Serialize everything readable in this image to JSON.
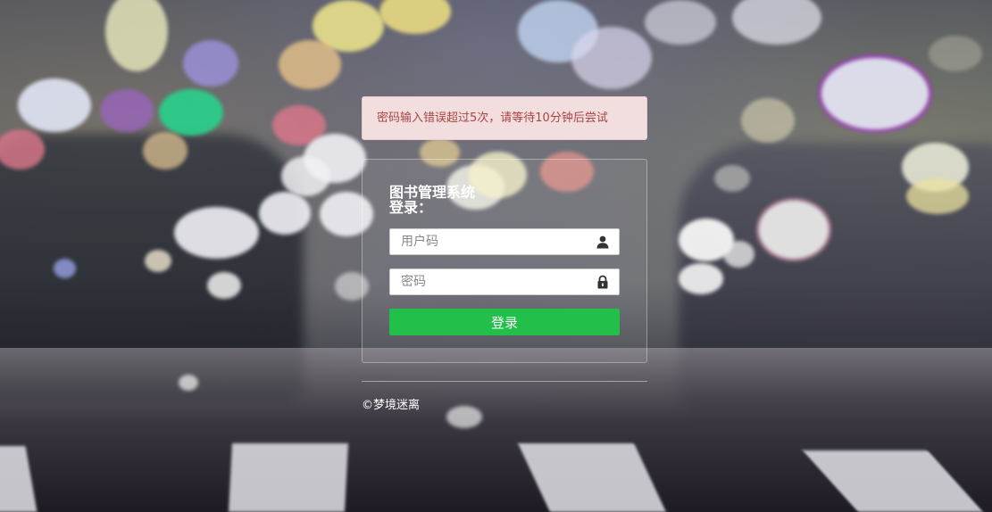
{
  "alert": {
    "message": "密码输入错误超过5次，请等待10分钟后尝试",
    "background_color": "#f2dede",
    "text_color": "#a94442"
  },
  "login": {
    "title": "图书管理系统登录：",
    "username_placeholder": "用户码",
    "username_icon": "user-icon",
    "password_placeholder": "密码",
    "password_icon": "lock-icon",
    "submit_label": "登录",
    "submit_color": "#22c04a"
  },
  "footer": {
    "copyright": "©梦境迷离"
  }
}
